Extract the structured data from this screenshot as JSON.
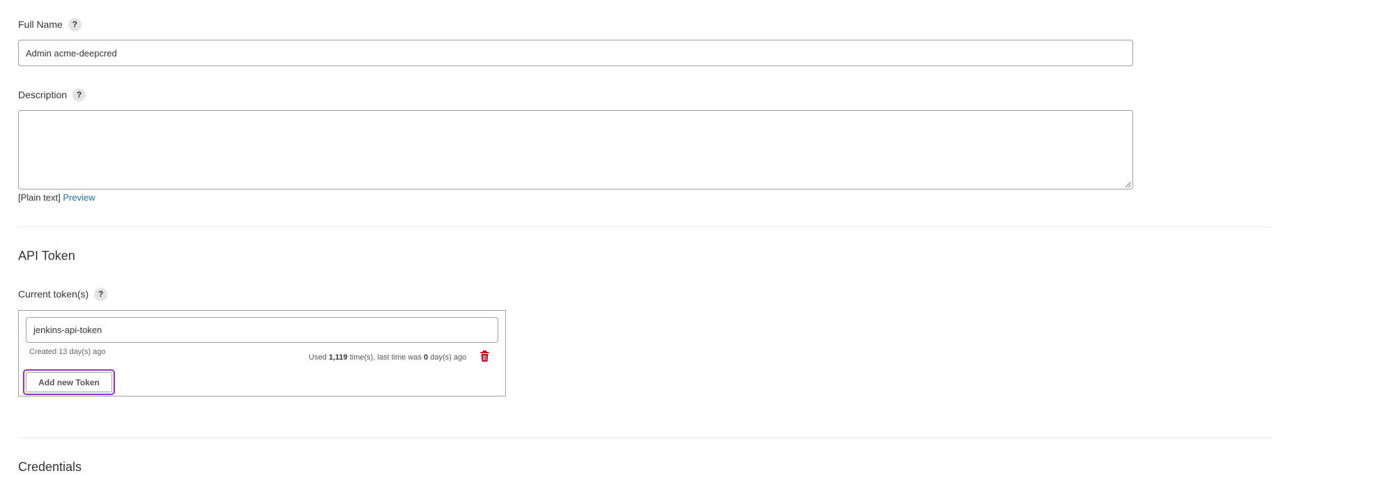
{
  "full_name": {
    "label": "Full Name",
    "help": "?",
    "value": "Admin acme-deepcred"
  },
  "description": {
    "label": "Description",
    "help": "?",
    "value": "",
    "markup_prefix": "[Plain text]",
    "preview_link": "Preview"
  },
  "api_token": {
    "section_title": "API Token",
    "current_tokens_label": "Current token(s)",
    "help": "?",
    "token": {
      "name": "jenkins-api-token",
      "created": "Created 13 day(s) ago",
      "used_prefix": "Used ",
      "used_count": "1,119",
      "used_middle": " time(s), last time was ",
      "last_days": "0",
      "used_suffix": " day(s) ago",
      "delete_icon": "trash-icon"
    },
    "add_button": "Add new Token"
  },
  "credentials": {
    "section_title": "Credentials"
  }
}
